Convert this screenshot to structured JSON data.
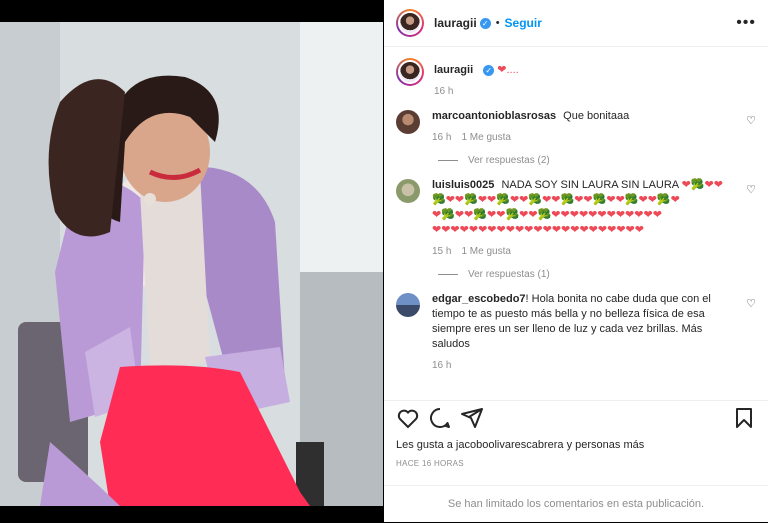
{
  "post": {
    "username": "lauragii",
    "follow_label": "Seguir",
    "more_icon": "more-icon",
    "caption_text": "❤....",
    "caption_time": "16 h"
  },
  "comments": [
    {
      "user": "marcoantonioblasrosas",
      "text": "Que bonitaaa",
      "time": "16 h",
      "likes": "1 Me gusta",
      "replies": "Ver respuestas (2)"
    },
    {
      "user": "luisluis0025",
      "text": "NADA SOY SIN LAURA SIN LAURA",
      "emoji_line1": "❤🥦❤❤",
      "emoji_line2": "🥦❤❤🥦❤❤🥦❤❤🥦❤❤🥦❤❤🥦❤❤🥦❤❤🥦❤",
      "emoji_line3": "❤🥦❤❤🥦❤❤🥦❤❤🥦❤❤❤❤❤❤❤❤❤❤❤❤",
      "emoji_line4": "❤❤❤❤❤❤❤❤❤❤❤❤❤❤❤❤❤❤❤❤❤❤❤",
      "time": "15 h",
      "likes": "1 Me gusta",
      "replies": "Ver respuestas (1)"
    },
    {
      "user": "edgar_escobedo7",
      "text": "! Hola bonita no cabe duda que con el tiempo te as puesto más bella y no belleza física de esa siempre eres un ser lleno de luz y cada vez brillas. Más saludos",
      "time": "16 h"
    }
  ],
  "actions": {
    "icons": [
      "heart-icon",
      "comment-icon",
      "share-icon",
      "save-icon"
    ]
  },
  "likes_text": "Les gusta a jacoboolivarescabrera y personas más",
  "timestamp": "HACE 16 HORAS",
  "comments_limited": "Se han limitado los comentarios en esta publicación.",
  "colors": {
    "accent": "#0095f6",
    "heart": "#ed4956",
    "blazer": "#b99ad6",
    "pants": "#ff2d55"
  }
}
